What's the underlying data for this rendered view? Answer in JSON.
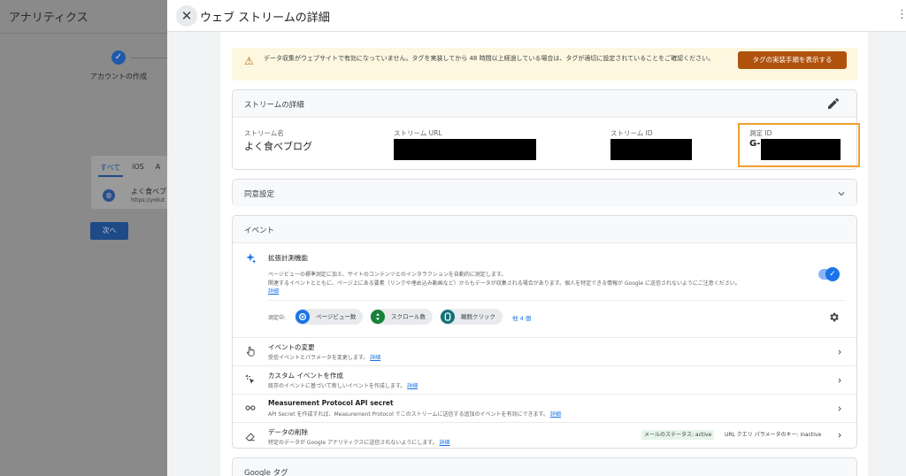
{
  "background": {
    "title": "アナリティクス",
    "step_label": "アカウントの作成",
    "tabs": [
      "すべて",
      "iOS",
      "A"
    ],
    "stream_name": "よく食べブ",
    "stream_url": "https://yokut",
    "next_button": "次へ"
  },
  "drawer": {
    "title": "ウェブ ストリームの詳細",
    "warning": {
      "text": "データ収集がウェブサイトで有効になっていません。タグを実装してから 48 時間以上経過している場合は、タグが適切に設定されていることをご確認ください。",
      "button": "タグの実装手順を表示する"
    },
    "stream_details": {
      "title": "ストリームの詳細",
      "name_label": "ストリーム名",
      "name_value": "よく食べブログ",
      "url_label": "ストリーム URL",
      "id_label": "ストリーム ID",
      "measurement_label": "測定 ID",
      "measurement_prefix": "G-"
    },
    "consent": {
      "title": "同意設定"
    },
    "events": {
      "title": "イベント",
      "enhanced": {
        "title": "拡張計測機能",
        "desc_line1": "ページビューの標準測定に加え、サイトのコンテンツとのインタラクションを自動的に測定します。",
        "desc_line2": "関連するイベントとともに、ページ上にある要素（リンクや埋め込み動画など）からもデータが収集される場合があります。個人を特定できる情報が Google に送信されないようにご注意ください。",
        "desc_link": "詳細",
        "measuring_label": "測定中:",
        "chips": [
          "ページビュー数",
          "スクロール数",
          "離脱クリック"
        ],
        "more": "他 4 個"
      },
      "rows": [
        {
          "title": "イベントの変更",
          "desc": "受信イベントとパラメータを変更します。",
          "link": "詳細"
        },
        {
          "title": "カスタム イベントを作成",
          "desc": "既存のイベントに基づいて新しいイベントを作成します。",
          "link": "詳細"
        },
        {
          "title": "Measurement Protocol API secret",
          "desc": "API Secret を作成すれば、Measurement Protocol でこのストリームに送信する追加のイベントを有効にできます。",
          "link": "詳細"
        },
        {
          "title": "データの削除",
          "desc": "特定のデータが Google アナリティクスに送信されないようにします。",
          "link": "詳細",
          "badge_active": "メールのステータス: active",
          "badge_inactive": "URL クエリ パラメータのキー: inactive"
        }
      ]
    },
    "google_tag": {
      "title": "Google タグ"
    }
  },
  "colors": {
    "accent": "#1a73e8",
    "warning_button": "#b0520d",
    "highlight": "#f0a030",
    "chip_pageview": "#1a73e8",
    "chip_scroll": "#188038",
    "chip_click": "#12737a"
  }
}
